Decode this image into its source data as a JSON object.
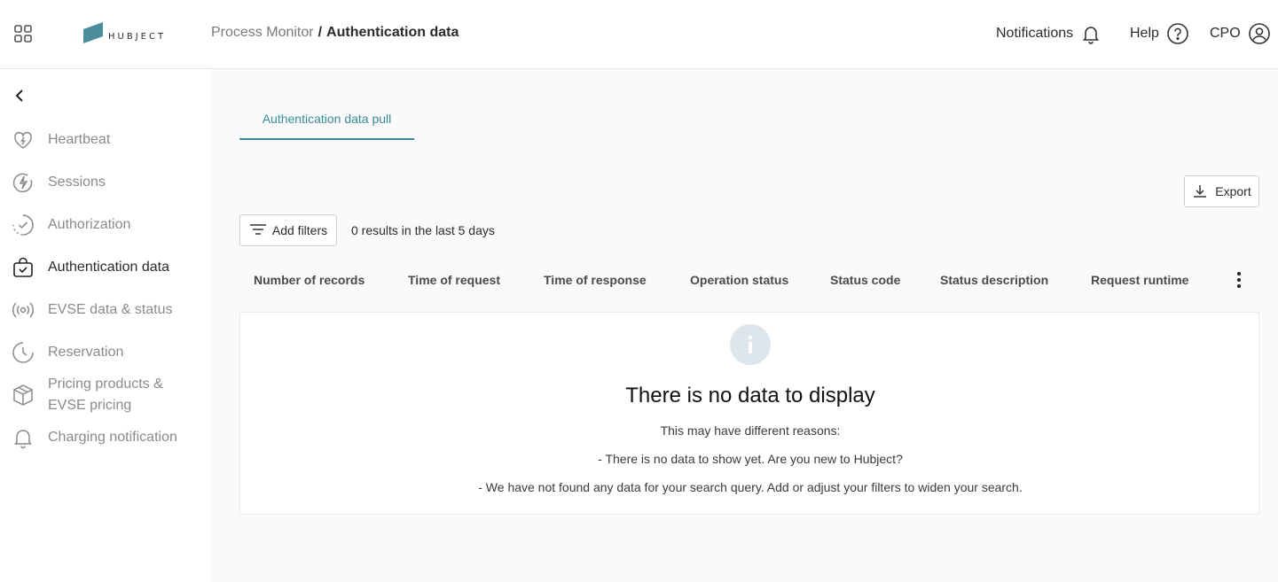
{
  "header": {
    "logo_text": "HUBJECT",
    "breadcrumb": {
      "parent": "Process Monitor",
      "separator": "/",
      "current": "Authentication data"
    },
    "notifications_label": "Notifications",
    "help_label": "Help",
    "user_label": "CPO"
  },
  "sidebar": {
    "items": [
      {
        "label": "Heartbeat",
        "icon": "heart-icon"
      },
      {
        "label": "Sessions",
        "icon": "bolt-icon"
      },
      {
        "label": "Authorization",
        "icon": "check-circle-icon"
      },
      {
        "label": "Authentication data",
        "icon": "bag-check-icon",
        "active": true
      },
      {
        "label": "EVSE data & status",
        "icon": "signal-icon"
      },
      {
        "label": "Reservation",
        "icon": "clock-icon"
      },
      {
        "label_line1": "Pricing products &",
        "label_line2": "EVSE pricing",
        "icon": "box-icon"
      },
      {
        "label": "Charging notification",
        "icon": "bell-icon"
      }
    ]
  },
  "main": {
    "tab_label": "Authentication data pull",
    "export_label": "Export",
    "add_filters_label": "Add filters",
    "results_text": "0 results in the last 5 days",
    "columns": [
      "Number of records",
      "Time of request",
      "Time of response",
      "Operation status",
      "Status code",
      "Status description",
      "Request runtime"
    ],
    "empty": {
      "title": "There is no data to display",
      "line1": "This may have different reasons:",
      "line2": "- There is no data to show yet. Are you new to Hubject?",
      "line3": "- We have not found any data for your search query. Add or adjust your filters to widen your search."
    }
  },
  "colors": {
    "accent": "#3a8a99",
    "logo": "#4b8d9b",
    "muted_text": "#8a8a8a",
    "info_circle": "#dde6ea"
  }
}
